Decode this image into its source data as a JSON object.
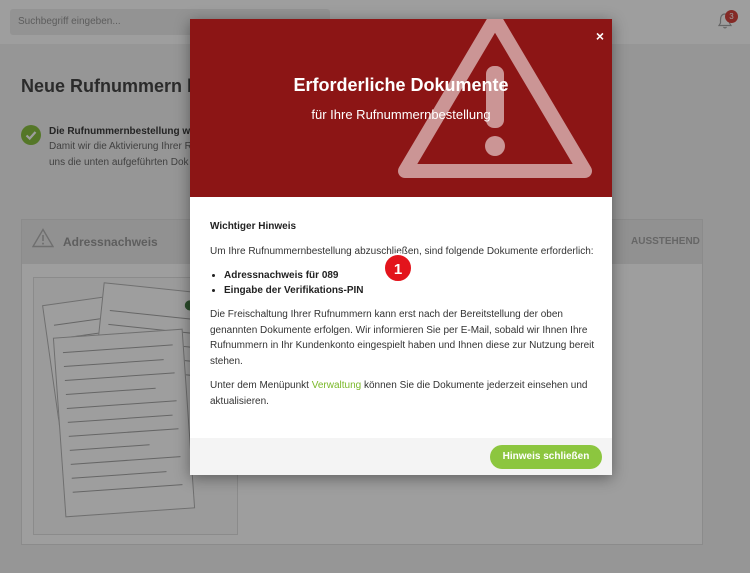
{
  "search": {
    "placeholder": "Suchbegriff eingeben..."
  },
  "notifications": {
    "count": "3"
  },
  "page": {
    "title": "Neue Rufnummern b",
    "message_title": "Die Rufnummernbestellung wu",
    "message_line1": "Damit wir die Aktivierung Ihrer R",
    "message_line2": "uns die unten aufgeführten Dok"
  },
  "document_card": {
    "title": "Adressnachweis",
    "status": "AUSSTEHEND"
  },
  "modal": {
    "title": "Erforderliche Dokumente",
    "subtitle": "für Ihre Rufnummernbestellung",
    "close_symbol": "×",
    "notice_heading": "Wichtiger Hinweis",
    "intro": "Um Ihre Rufnummernbestellung abzuschließen, sind folgende Dokumente erforderlich:",
    "required_documents": [
      "Adressnachweis für 089",
      "Eingabe der Verifikations-PIN"
    ],
    "step_badge": "1",
    "info": "Die Freischaltung Ihrer Rufnummern kann erst nach der Bereitstellung der oben genannten Dokumente erfolgen. Wir informieren Sie per E-Mail, sobald wir Ihnen Ihre Rufnummern in Ihr Kundenkonto eingespielt haben und Ihnen diese zur Nutzung bereit stehen.",
    "menu_hint_before": "Unter dem Menüpunkt ",
    "menu_link": "Verwaltung",
    "menu_hint_after": " können Sie die Dokumente jederzeit einsehen und aktualisieren.",
    "close_button": "Hinweis schließen"
  },
  "colors": {
    "accent_green": "#8cc63f",
    "hero_red": "#8c1515",
    "badge_red": "#e3141c"
  },
  "icons": {
    "notification": "bell-icon",
    "warning": "warning-triangle-icon",
    "success": "check-circle-icon",
    "close": "close-icon"
  }
}
